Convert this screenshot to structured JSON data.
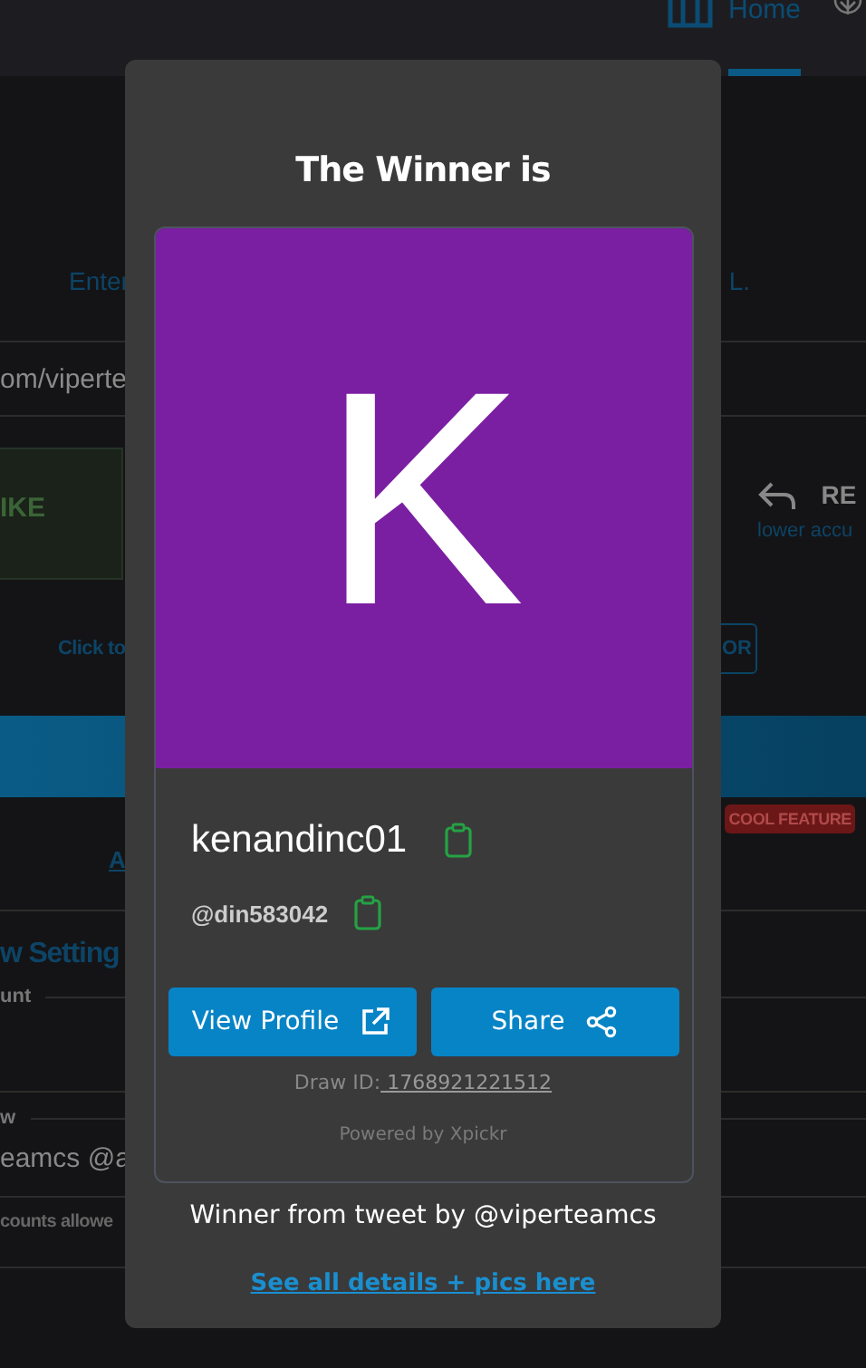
{
  "nav": {
    "home_label": "Home",
    "selected": true
  },
  "page": {
    "intro_left": "Enter",
    "intro_right": "L.",
    "url_field_value": "om/viperte",
    "like_option": "IKE",
    "reply_label": "RE",
    "reply_hint": "lower accu",
    "click_text": "Click to",
    "or_button": "OR",
    "badge": "COOL FEATURE",
    "link_fragment": "A",
    "section_title": "w Setting",
    "field_1_label": "unt",
    "field_2_label": "w",
    "field_2_value": "eamcs @a",
    "field_3_label": "counts allowe"
  },
  "modal": {
    "title": "The Winner is",
    "avatar_letter": "K",
    "name": "kenandinc01",
    "handle": "@din583042",
    "buttons": [
      {
        "kind": "profile",
        "label": "View Profile"
      },
      {
        "kind": "share",
        "label": "Share"
      }
    ],
    "draw_id_label": "Draw ID:",
    "draw_id": " 1768921221512",
    "powered_by": "Powered by Xpickr",
    "tweet_line": "Winner from tweet by @viperteamcs",
    "details_link": "See all details + pics here"
  }
}
